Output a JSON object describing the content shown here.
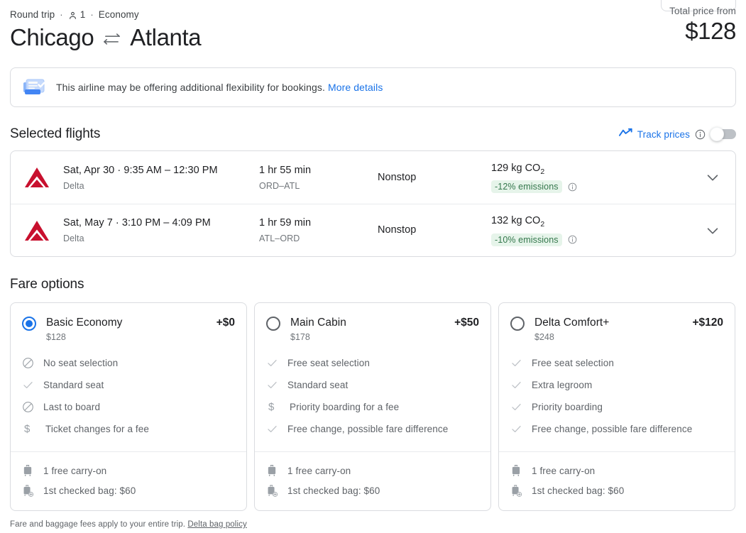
{
  "header": {
    "trip_type": "Round trip",
    "separator": "·",
    "passengers": "1",
    "cabin": "Economy",
    "origin": "Chicago",
    "destination": "Atlanta",
    "swap_icon": "swap-arrows-icon",
    "total_price_label": "Total price from",
    "total_price": "$128"
  },
  "banner": {
    "icon": "flexible-ticket-icon",
    "text": "This airline may be offering additional flexibility for bookings.",
    "link": "More details"
  },
  "selected_flights": {
    "title": "Selected flights",
    "track_prices": {
      "icon": "trending-up-icon",
      "label": "Track prices",
      "info_icon": "info-icon",
      "enabled": false
    },
    "rows": [
      {
        "airline_logo": "delta-logo",
        "date_and_times": "Sat, Apr 30 · 9:35 AM – 12:30 PM",
        "airline": "Delta",
        "duration": "1 hr 55 min",
        "route": "ORD–ATL",
        "stops": "Nonstop",
        "emissions_amount": "129 kg CO",
        "emissions_sub": "2",
        "emissions_badge": "-12% emissions",
        "badge_info_icon": "info-icon",
        "expand_icon": "chevron-down-icon"
      },
      {
        "airline_logo": "delta-logo",
        "date_and_times": "Sat, May 7 · 3:10 PM – 4:09 PM",
        "airline": "Delta",
        "duration": "1 hr 59 min",
        "route": "ATL–ORD",
        "stops": "Nonstop",
        "emissions_amount": "132 kg CO",
        "emissions_sub": "2",
        "emissions_badge": "-10% emissions",
        "badge_info_icon": "info-icon",
        "expand_icon": "chevron-down-icon"
      }
    ]
  },
  "fare_options": {
    "title": "Fare options",
    "cards": [
      {
        "selected": true,
        "name": "Basic Economy",
        "price": "$128",
        "delta": "+$0",
        "features": [
          {
            "icon": "not-allowed-icon",
            "text": "No seat selection"
          },
          {
            "icon": "check-icon",
            "text": "Standard seat"
          },
          {
            "icon": "not-allowed-icon",
            "text": "Last to board"
          },
          {
            "icon": "dollar-icon",
            "text": "Ticket changes for a fee"
          }
        ],
        "bags": [
          {
            "icon": "carry-on-bag-icon",
            "text": "1 free carry-on"
          },
          {
            "icon": "checked-bag-add-icon",
            "text": "1st checked bag: $60"
          }
        ]
      },
      {
        "selected": false,
        "name": "Main Cabin",
        "price": "$178",
        "delta": "+$50",
        "features": [
          {
            "icon": "check-icon",
            "text": "Free seat selection"
          },
          {
            "icon": "check-icon",
            "text": "Standard seat"
          },
          {
            "icon": "dollar-icon",
            "text": "Priority boarding for a fee"
          },
          {
            "icon": "check-icon",
            "text": "Free change, possible fare difference"
          }
        ],
        "bags": [
          {
            "icon": "carry-on-bag-icon",
            "text": "1 free carry-on"
          },
          {
            "icon": "checked-bag-add-icon",
            "text": "1st checked bag: $60"
          }
        ]
      },
      {
        "selected": false,
        "name": "Delta Comfort+",
        "price": "$248",
        "delta": "+$120",
        "features": [
          {
            "icon": "check-icon",
            "text": "Free seat selection"
          },
          {
            "icon": "check-icon",
            "text": "Extra legroom"
          },
          {
            "icon": "check-icon",
            "text": "Priority boarding"
          },
          {
            "icon": "check-icon",
            "text": "Free change, possible fare difference"
          }
        ],
        "bags": [
          {
            "icon": "carry-on-bag-icon",
            "text": "1 free carry-on"
          },
          {
            "icon": "checked-bag-add-icon",
            "text": "1st checked bag: $60"
          }
        ]
      }
    ]
  },
  "footnote": {
    "text": "Fare and baggage fees apply to your entire trip.",
    "link": "Delta bag policy"
  },
  "colors": {
    "accent_blue": "#1a73e8",
    "text_primary": "#202124",
    "text_secondary": "#5f6368",
    "badge_green_bg": "#e6f4ea",
    "badge_green_text": "#34774c",
    "delta_red": "#c8102e",
    "border": "#dadce0"
  }
}
